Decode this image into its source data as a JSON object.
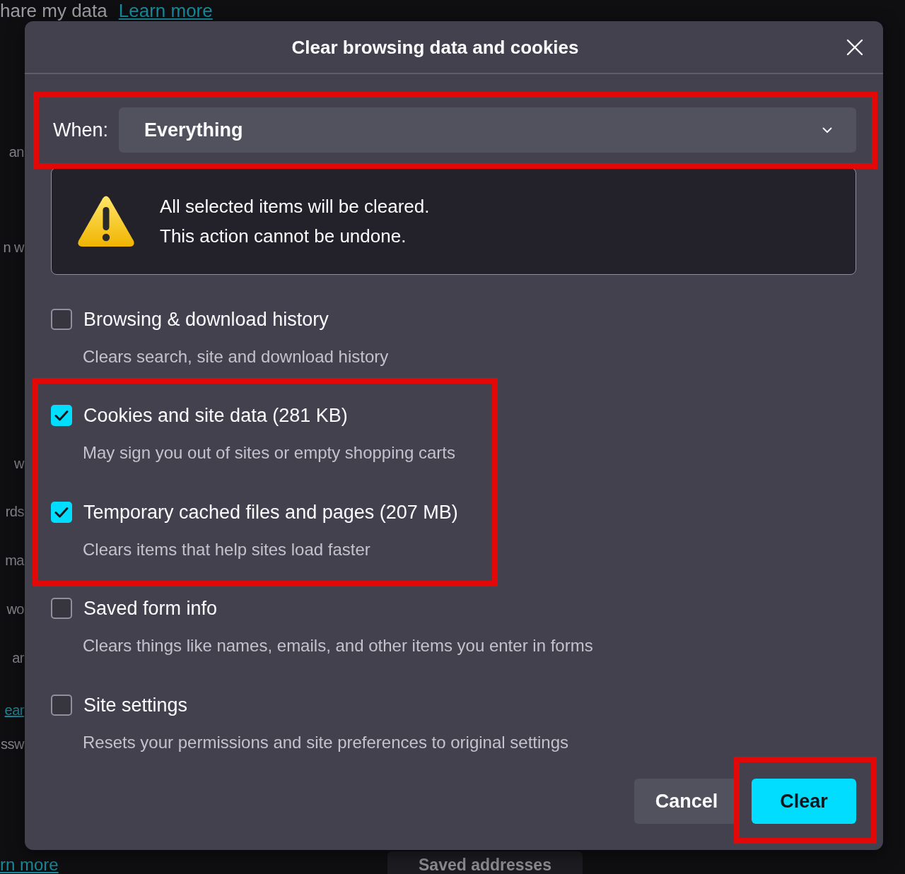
{
  "background_page": {
    "intro": {
      "text": "hare my data",
      "link": "Learn more"
    },
    "fragments": [
      {
        "text": "an",
        "kind": "text"
      },
      {
        "text": "n w",
        "kind": "text"
      },
      {
        "text": "w",
        "kind": "text"
      },
      {
        "text": "rds",
        "kind": "text"
      },
      {
        "text": "ma",
        "kind": "text"
      },
      {
        "text": "wo",
        "kind": "text"
      },
      {
        "text": "ar",
        "kind": "text"
      },
      {
        "text": "ear",
        "kind": "link"
      },
      {
        "text": "ssw",
        "kind": "text"
      }
    ],
    "footer_link": "rn more",
    "button": "Saved addresses"
  },
  "dialog": {
    "title": "Clear browsing data and cookies",
    "when": {
      "label": "When:",
      "value": "Everything",
      "highlighted": true
    },
    "warning": {
      "lines": [
        "All selected items will be cleared.",
        "This action cannot be undone."
      ]
    },
    "options": [
      {
        "label": "Browsing & download history",
        "description": "Clears search, site and download history",
        "checked": false,
        "highlighted": false
      },
      {
        "label": "Cookies and site data (281 KB)",
        "description": "May sign you out of sites or empty shopping carts",
        "checked": true,
        "highlighted": true
      },
      {
        "label": "Temporary cached files and pages (207 MB)",
        "description": "Clears items that help sites load faster",
        "checked": true,
        "highlighted": true
      },
      {
        "label": "Saved form info",
        "description": "Clears things like names, emails, and other items you enter in forms",
        "checked": false,
        "highlighted": false
      },
      {
        "label": "Site settings",
        "description": "Resets your permissions and site preferences to original settings",
        "checked": false,
        "highlighted": false
      }
    ],
    "buttons": [
      {
        "label": "Cancel",
        "kind": "secondary",
        "highlighted": false
      },
      {
        "label": "Clear",
        "kind": "primary",
        "highlighted": true
      }
    ]
  }
}
